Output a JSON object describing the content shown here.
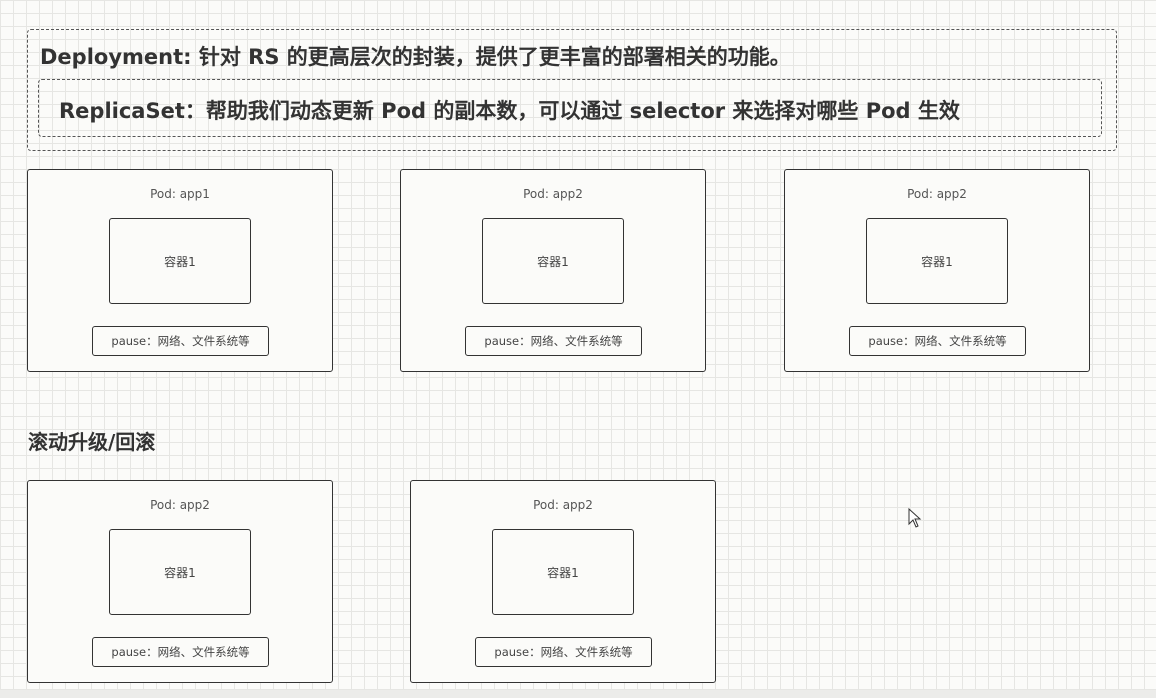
{
  "deployment": {
    "text": "Deployment: 针对 RS 的更高层次的封装，提供了更丰富的部署相关的功能。"
  },
  "replicaset": {
    "text": "ReplicaSet：帮助我们动态更新 Pod 的副本数，可以通过 selector 来选择对哪些 Pod 生效"
  },
  "pods_top": [
    {
      "title": "Pod: app1",
      "container": "容器1",
      "pause": "pause：网络、文件系统等"
    },
    {
      "title": "Pod: app2",
      "container": "容器1",
      "pause": "pause：网络、文件系统等"
    },
    {
      "title": "Pod: app2",
      "container": "容器1",
      "pause": "pause：网络、文件系统等"
    }
  ],
  "rolling": {
    "heading": "滚动升级/回滚"
  },
  "pods_bottom": [
    {
      "title": "Pod: app2",
      "container": "容器1",
      "pause": "pause：网络、文件系统等"
    },
    {
      "title": "Pod: app2",
      "container": "容器1",
      "pause": "pause：网络、文件系统等"
    }
  ]
}
